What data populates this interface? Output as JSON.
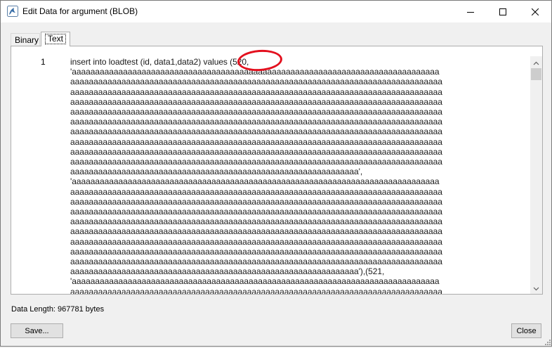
{
  "window": {
    "title": "Edit Data for argument (BLOB)",
    "icon": "dolphin-app-icon"
  },
  "tabs": [
    {
      "label": "Binary",
      "active": false
    },
    {
      "label": "Text",
      "active": true
    }
  ],
  "editor": {
    "line_number": "1",
    "lines": [
      "insert into loadtest (id, data1,data2) values (520,",
      "'aaaaaaaaaaaaaaaaaaaaaaaaaaaaaaaaaaaaaaaaaaaaaaaaaaaaaaaaaaaaaaaaaaaaaaaaaaaaaaa",
      "aaaaaaaaaaaaaaaaaaaaaaaaaaaaaaaaaaaaaaaaaaaaaaaaaaaaaaaaaaaaaaaaaaaaaaaaaaaaaaaa",
      "aaaaaaaaaaaaaaaaaaaaaaaaaaaaaaaaaaaaaaaaaaaaaaaaaaaaaaaaaaaaaaaaaaaaaaaaaaaaaaaa",
      "aaaaaaaaaaaaaaaaaaaaaaaaaaaaaaaaaaaaaaaaaaaaaaaaaaaaaaaaaaaaaaaaaaaaaaaaaaaaaaaa",
      "aaaaaaaaaaaaaaaaaaaaaaaaaaaaaaaaaaaaaaaaaaaaaaaaaaaaaaaaaaaaaaaaaaaaaaaaaaaaaaaa",
      "aaaaaaaaaaaaaaaaaaaaaaaaaaaaaaaaaaaaaaaaaaaaaaaaaaaaaaaaaaaaaaaaaaaaaaaaaaaaaaaa",
      "aaaaaaaaaaaaaaaaaaaaaaaaaaaaaaaaaaaaaaaaaaaaaaaaaaaaaaaaaaaaaaaaaaaaaaaaaaaaaaaa",
      "aaaaaaaaaaaaaaaaaaaaaaaaaaaaaaaaaaaaaaaaaaaaaaaaaaaaaaaaaaaaaaaaaaaaaaaaaaaaaaaa",
      "aaaaaaaaaaaaaaaaaaaaaaaaaaaaaaaaaaaaaaaaaaaaaaaaaaaaaaaaaaaaaaaaaaaaaaaaaaaaaaaa",
      "aaaaaaaaaaaaaaaaaaaaaaaaaaaaaaaaaaaaaaaaaaaaaaaaaaaaaaaaaaaaaaaaaaaaaaaaaaaaaaaa",
      "aaaaaaaaaaaaaaaaaaaaaaaaaaaaaaaaaaaaaaaaaaaaaaaaaaaaaaaaaaaaaa',",
      "'aaaaaaaaaaaaaaaaaaaaaaaaaaaaaaaaaaaaaaaaaaaaaaaaaaaaaaaaaaaaaaaaaaaaaaaaaaaaaaa",
      "aaaaaaaaaaaaaaaaaaaaaaaaaaaaaaaaaaaaaaaaaaaaaaaaaaaaaaaaaaaaaaaaaaaaaaaaaaaaaaaa",
      "aaaaaaaaaaaaaaaaaaaaaaaaaaaaaaaaaaaaaaaaaaaaaaaaaaaaaaaaaaaaaaaaaaaaaaaaaaaaaaaa",
      "aaaaaaaaaaaaaaaaaaaaaaaaaaaaaaaaaaaaaaaaaaaaaaaaaaaaaaaaaaaaaaaaaaaaaaaaaaaaaaaa",
      "aaaaaaaaaaaaaaaaaaaaaaaaaaaaaaaaaaaaaaaaaaaaaaaaaaaaaaaaaaaaaaaaaaaaaaaaaaaaaaaa",
      "aaaaaaaaaaaaaaaaaaaaaaaaaaaaaaaaaaaaaaaaaaaaaaaaaaaaaaaaaaaaaaaaaaaaaaaaaaaaaaaa",
      "aaaaaaaaaaaaaaaaaaaaaaaaaaaaaaaaaaaaaaaaaaaaaaaaaaaaaaaaaaaaaaaaaaaaaaaaaaaaaaaa",
      "aaaaaaaaaaaaaaaaaaaaaaaaaaaaaaaaaaaaaaaaaaaaaaaaaaaaaaaaaaaaaaaaaaaaaaaaaaaaaaaa",
      "aaaaaaaaaaaaaaaaaaaaaaaaaaaaaaaaaaaaaaaaaaaaaaaaaaaaaaaaaaaaaaaaaaaaaaaaaaaaaaaa",
      "aaaaaaaaaaaaaaaaaaaaaaaaaaaaaaaaaaaaaaaaaaaaaaaaaaaaaaaaaaaaaa'),(521,",
      "'aaaaaaaaaaaaaaaaaaaaaaaaaaaaaaaaaaaaaaaaaaaaaaaaaaaaaaaaaaaaaaaaaaaaaaaaaaaaaaa",
      "aaaaaaaaaaaaaaaaaaaaaaaaaaaaaaaaaaaaaaaaaaaaaaaaaaaaaaaaaaaaaaaaaaaaaaaaaaaaaaaa",
      "aaaaaaaaaaaaaaaaaaaaaaaaaaaaaaaaaaaaaaaaaaaaaaaaaaaaaaaaaaaaaaaaaaaaaaaaaaaaaaaa"
    ]
  },
  "status": {
    "data_length": "Data Length: 967781 bytes"
  },
  "buttons": {
    "save_label": "Save...",
    "close_label": "Close"
  },
  "colors": {
    "annotation": "#e3101e",
    "panel_border": "#adadad",
    "button_bg": "#e1e1e1"
  }
}
